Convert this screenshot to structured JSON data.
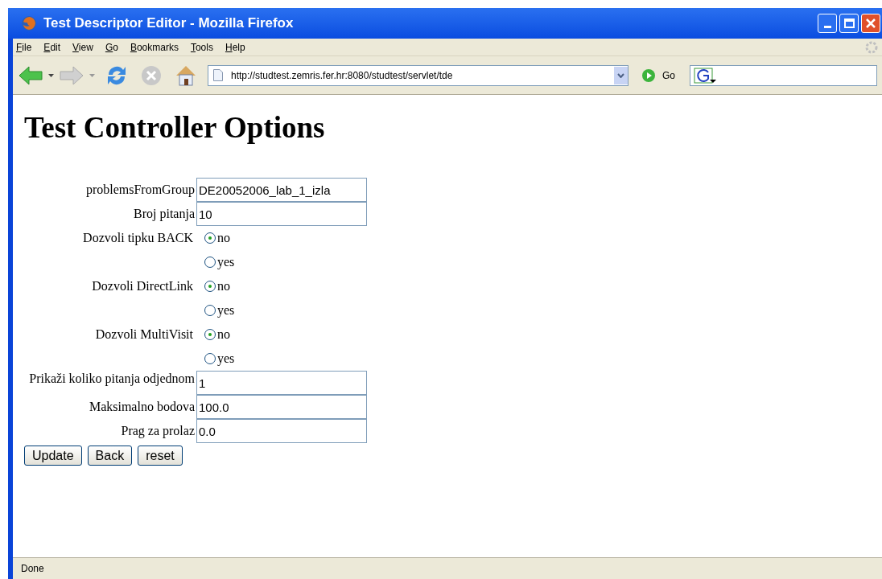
{
  "window": {
    "title": "Test Descriptor Editor - Mozilla Firefox"
  },
  "menu": [
    "File",
    "Edit",
    "View",
    "Go",
    "Bookmarks",
    "Tools",
    "Help"
  ],
  "toolbar": {
    "url": "http://studtest.zemris.fer.hr:8080/studtest/servlet/tde",
    "go": "Go"
  },
  "page": {
    "heading": "Test Controller Options",
    "fields": [
      {
        "kind": "text",
        "label": "problemsFromGroup",
        "value": "DE20052006_lab_1_izla"
      },
      {
        "kind": "text",
        "label": "Broj pitanja",
        "value": "10"
      },
      {
        "kind": "radio",
        "label": "Dozvoli tipku BACK",
        "options": [
          {
            "label": "no",
            "selected": true
          },
          {
            "label": "yes",
            "selected": false
          }
        ]
      },
      {
        "kind": "radio",
        "label": "Dozvoli DirectLink",
        "options": [
          {
            "label": "no",
            "selected": true
          },
          {
            "label": "yes",
            "selected": false
          }
        ]
      },
      {
        "kind": "radio",
        "label": "Dozvoli MultiVisit",
        "options": [
          {
            "label": "no",
            "selected": true
          },
          {
            "label": "yes",
            "selected": false
          }
        ]
      },
      {
        "kind": "text",
        "label": "Prikaži koliko pitanja odjednom",
        "value": "1"
      },
      {
        "kind": "text",
        "label": "Maksimalno bodova",
        "value": "100.0"
      },
      {
        "kind": "text",
        "label": "Prag za prolaz",
        "value": "0.0"
      }
    ],
    "buttons": [
      "Update",
      "Back",
      "reset"
    ]
  },
  "status_bar": "Done"
}
